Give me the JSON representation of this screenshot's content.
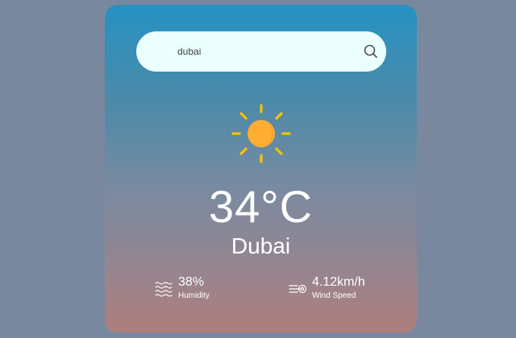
{
  "search": {
    "value": "dubai",
    "icon": "search-icon"
  },
  "weather": {
    "icon": "sun-icon",
    "temperature": "34°C",
    "city": "Dubai"
  },
  "details": {
    "humidity": {
      "icon": "humidity-icon",
      "value": "38%",
      "label": "Humidity"
    },
    "wind": {
      "icon": "wind-icon",
      "value": "4.12km/h",
      "label": "Wind Speed"
    }
  },
  "colors": {
    "page_background": "#7a889f",
    "card_top": "#2592c2",
    "card_bottom": "#ae7e7c",
    "search_background": "#ebfffc",
    "sun": "#ffad33",
    "sun_rays": "#f5c400",
    "text": "#ffffff"
  }
}
